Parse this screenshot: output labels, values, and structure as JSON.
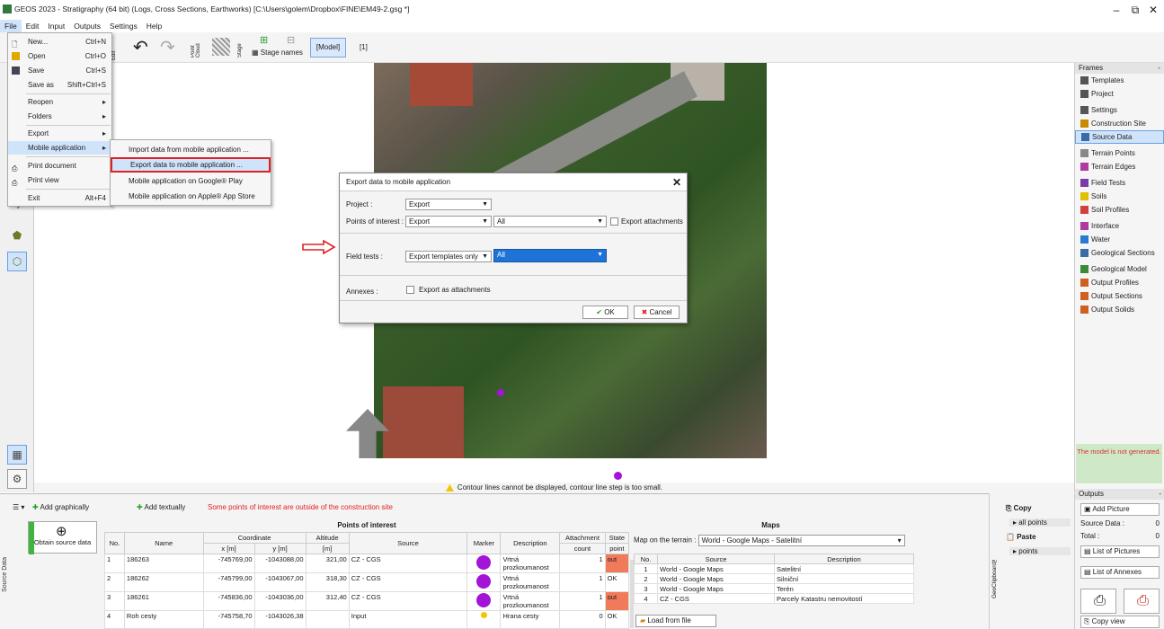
{
  "window": {
    "title": "GEOS 2023 - Stratigraphy (64 bit) (Logs, Cross Sections, Earthworks) [C:\\Users\\golem\\Dropbox\\FINE\\EM49-2.gsg *]",
    "minimize": "–",
    "restore": "⧉",
    "close": "✕"
  },
  "menubar": [
    "File",
    "Edit",
    "Input",
    "Outputs",
    "Settings",
    "Help"
  ],
  "toolbar": {
    "model": "[Model]",
    "stage_index": "[1]",
    "stage_names": "Stage names",
    "point_cloud": "Point Cloud",
    "stage": "Stage",
    "edit": "Edit"
  },
  "file_menu": {
    "items": [
      {
        "label": "New...",
        "shortcut": "Ctrl+N"
      },
      {
        "label": "Open",
        "shortcut": "Ctrl+O"
      },
      {
        "label": "Save",
        "shortcut": "Ctrl+S"
      },
      {
        "label": "Save as",
        "shortcut": "Shift+Ctrl+S"
      },
      {
        "label": "Reopen",
        "shortcut": ""
      },
      {
        "label": "Folders",
        "shortcut": ""
      },
      {
        "label": "Export",
        "shortcut": ""
      },
      {
        "label": "Mobile application",
        "shortcut": ""
      },
      {
        "label": "Print document",
        "shortcut": ""
      },
      {
        "label": "Print view",
        "shortcut": ""
      },
      {
        "label": "Exit",
        "shortcut": "Alt+F4"
      }
    ]
  },
  "submenu": [
    "Import data from mobile application ...",
    "Export data to mobile application ...",
    "Mobile application on Google® Play",
    "Mobile application on Apple® App Store"
  ],
  "dialog": {
    "title": "Export data to mobile application",
    "project_label": "Project :",
    "project_value": "Export",
    "poi_label": "Points of interest :",
    "poi_value": "Export",
    "poi_scope": "All",
    "export_attachments": "Export attachments",
    "field_tests_label": "Field tests :",
    "field_tests_value": "Export templates only",
    "field_tests_scope": "All",
    "annexes_label": "Annexes :",
    "annexes_option": "Export as attachments",
    "ok": "OK",
    "cancel": "Cancel"
  },
  "status_warning": "Contour lines cannot be displayed, contour line step is too small.",
  "right_panel": {
    "header": "Frames",
    "groups": [
      [
        {
          "label": "Templates",
          "icon": "templates-icon",
          "color": "#555"
        },
        {
          "label": "Project",
          "icon": "project-icon",
          "color": "#555"
        }
      ],
      [
        {
          "label": "Settings",
          "icon": "settings-icon",
          "color": "#555"
        },
        {
          "label": "Construction Site",
          "icon": "construction-site-icon",
          "color": "#c88a00"
        },
        {
          "label": "Source Data",
          "icon": "source-data-icon",
          "color": "#3a6aa8",
          "active": true
        }
      ],
      [
        {
          "label": "Terrain Points",
          "icon": "terrain-points-icon",
          "color": "#888"
        },
        {
          "label": "Terrain Edges",
          "icon": "terrain-edges-icon",
          "color": "#b03aa0"
        }
      ],
      [
        {
          "label": "Field Tests",
          "icon": "field-tests-icon",
          "color": "#7a3aa8"
        },
        {
          "label": "Soils",
          "icon": "soils-icon",
          "color": "#e0c000"
        },
        {
          "label": "Soil Profiles",
          "icon": "soil-profiles-icon",
          "color": "#d04040"
        }
      ],
      [
        {
          "label": "Interface",
          "icon": "interface-icon",
          "color": "#b03aa0"
        },
        {
          "label": "Water",
          "icon": "water-icon",
          "color": "#2a7ad0"
        },
        {
          "label": "Geological Sections",
          "icon": "geological-sections-icon",
          "color": "#3a6aa8"
        }
      ],
      [
        {
          "label": "Geological Model",
          "icon": "geological-model-icon",
          "color": "#3a8a3a"
        },
        {
          "label": "Output Profiles",
          "icon": "output-profiles-icon",
          "color": "#d06020"
        },
        {
          "label": "Output Sections",
          "icon": "output-sections-icon",
          "color": "#d06020"
        },
        {
          "label": "Output Solids",
          "icon": "output-solids-icon",
          "color": "#d06020"
        }
      ]
    ],
    "model_status": "The model is not generated."
  },
  "bottom": {
    "side_label": "Source Data",
    "add_graphically": "Add graphically",
    "add_textually": "Add textually",
    "outside_warning": "Some points of interest are outside of the construction site",
    "obtain_source": "Obtain source data",
    "poi_title": "Points of interest",
    "poi_columns": {
      "no": "No.",
      "name": "Name",
      "coordinate": "Coordinate",
      "x": "x [m]",
      "y": "y [m]",
      "altitude": "Altitude",
      "altitude_unit": "[m]",
      "source": "Source",
      "marker": "Marker",
      "description": "Description",
      "attachment": "Attachment",
      "attachment_sub": "count",
      "state": "State",
      "state_sub": "point"
    },
    "poi_rows": [
      {
        "no": "1",
        "name": "186263",
        "x": "-745769,00",
        "y": "-1043088,00",
        "alt": "321,00",
        "source": "CZ - CGS",
        "desc": "Vrtná prozkoumanost",
        "count": "1",
        "state": "out"
      },
      {
        "no": "2",
        "name": "186262",
        "x": "-745799,00",
        "y": "-1043067,00",
        "alt": "318,30",
        "source": "CZ - CGS",
        "desc": "Vrtná prozkoumanost",
        "count": "1",
        "state": "OK"
      },
      {
        "no": "3",
        "name": "186261",
        "x": "-745836,00",
        "y": "-1043036,00",
        "alt": "312,40",
        "source": "CZ - CGS",
        "desc": "Vrtná prozkoumanost",
        "count": "1",
        "state": "out"
      },
      {
        "no": "4",
        "name": "Roh cesty",
        "x": "-745758,70",
        "y": "-1043026,38",
        "alt": "",
        "source": "Input",
        "desc": "Hrana cesty",
        "count": "0",
        "state": "OK"
      }
    ],
    "maps_title": "Maps",
    "maps_label": "Map on the terrain :",
    "maps_value": "World - Google Maps - Satelitní",
    "maps_columns": {
      "no": "No.",
      "source": "Source",
      "description": "Description"
    },
    "maps_rows": [
      {
        "no": "1",
        "source": "World - Google Maps",
        "desc": "Satelitní"
      },
      {
        "no": "2",
        "source": "World - Google Maps",
        "desc": "Silniční"
      },
      {
        "no": "3",
        "source": "World - Google Maps",
        "desc": "Terén"
      },
      {
        "no": "4",
        "source": "CZ - CGS",
        "desc": "Parcely Katastru nemovitostí"
      }
    ],
    "load_from_file": "Load from file"
  },
  "clipboard": {
    "copy": "Copy",
    "all_points": "all points",
    "paste": "Paste",
    "points": "points",
    "side_label": "GeoClipboard™"
  },
  "outputs": {
    "header": "Outputs",
    "add_picture": "Add Picture",
    "source_data_label": "Source Data :",
    "source_data_value": "0",
    "total_label": "Total :",
    "total_value": "0",
    "list_pictures": "List of Pictures",
    "list_annexes": "List of Annexes",
    "copy_view": "Copy view"
  }
}
